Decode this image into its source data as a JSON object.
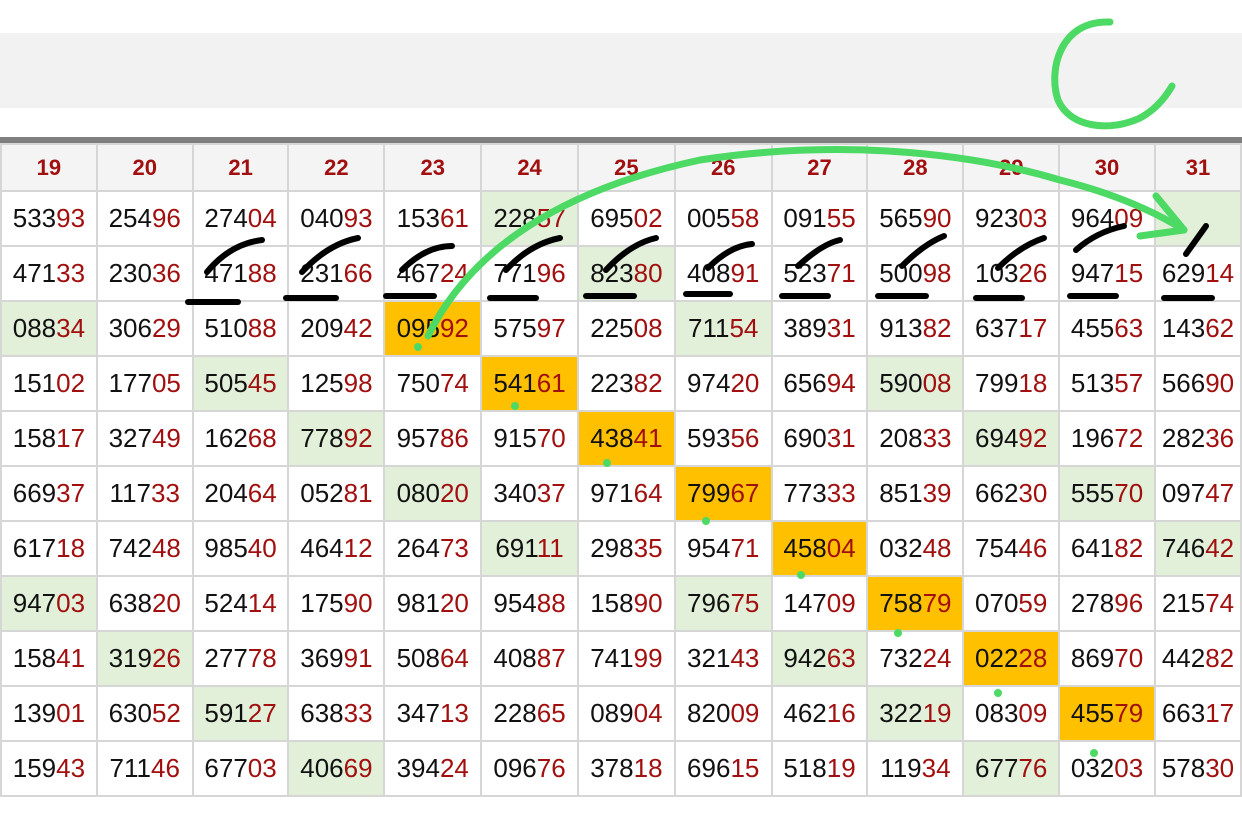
{
  "columns": [
    "19",
    "20",
    "21",
    "22",
    "23",
    "24",
    "25",
    "26",
    "27",
    "28",
    "29",
    "30",
    "31"
  ],
  "rows": [
    [
      "53393",
      "25496",
      "27404",
      "04093",
      "15361",
      "22857",
      "69502",
      "00558",
      "09155",
      "56590",
      "92303",
      "96409",
      ""
    ],
    [
      "47133",
      "23036",
      "47188",
      "23166",
      "46724",
      "77196",
      "82380",
      "40891",
      "52371",
      "50098",
      "10326",
      "94715",
      "62914"
    ],
    [
      "08834",
      "30629",
      "51088",
      "20942",
      "09592",
      "57597",
      "22508",
      "71154",
      "38931",
      "91382",
      "63717",
      "45563",
      "14362"
    ],
    [
      "15102",
      "17705",
      "50545",
      "12598",
      "75074",
      "54161",
      "22382",
      "97420",
      "65694",
      "59008",
      "79918",
      "51357",
      "56690"
    ],
    [
      "15817",
      "32749",
      "16268",
      "77892",
      "95786",
      "91570",
      "43841",
      "59356",
      "69031",
      "20833",
      "69492",
      "19672",
      "28236"
    ],
    [
      "66937",
      "11733",
      "20464",
      "05281",
      "08020",
      "34037",
      "97164",
      "79967",
      "77333",
      "85139",
      "66230",
      "55570",
      "09747"
    ],
    [
      "61718",
      "74248",
      "98540",
      "46412",
      "26473",
      "69111",
      "29835",
      "95471",
      "45804",
      "03248",
      "75446",
      "64182",
      "74642"
    ],
    [
      "94703",
      "63820",
      "52414",
      "17590",
      "98120",
      "95488",
      "15890",
      "79675",
      "14709",
      "75879",
      "07059",
      "27896",
      "21574"
    ],
    [
      "15841",
      "31926",
      "27778",
      "36991",
      "50864",
      "40887",
      "74199",
      "32143",
      "94263",
      "73224",
      "02228",
      "86970",
      "44282"
    ],
    [
      "13901",
      "63052",
      "59127",
      "63833",
      "34713",
      "22865",
      "08904",
      "82009",
      "46216",
      "32219",
      "08309",
      "45579",
      "66317"
    ],
    [
      "15943",
      "71146",
      "67703",
      "40669",
      "39424",
      "09676",
      "37818",
      "69615",
      "51819",
      "11934",
      "67776",
      "03203",
      "57830"
    ]
  ],
  "highlights": {
    "green": [
      [
        0,
        5
      ],
      [
        0,
        12
      ],
      [
        1,
        6
      ],
      [
        2,
        0
      ],
      [
        2,
        7
      ],
      [
        3,
        2
      ],
      [
        3,
        9
      ],
      [
        4,
        3
      ],
      [
        4,
        10
      ],
      [
        5,
        4
      ],
      [
        5,
        11
      ],
      [
        6,
        5
      ],
      [
        6,
        12
      ],
      [
        7,
        0
      ],
      [
        7,
        7
      ],
      [
        8,
        1
      ],
      [
        8,
        8
      ],
      [
        9,
        2
      ],
      [
        9,
        9
      ],
      [
        10,
        3
      ],
      [
        10,
        10
      ]
    ],
    "gold": [
      [
        2,
        4
      ],
      [
        3,
        5
      ],
      [
        4,
        6
      ],
      [
        5,
        7
      ],
      [
        6,
        8
      ],
      [
        7,
        9
      ],
      [
        8,
        10
      ],
      [
        9,
        11
      ]
    ]
  },
  "colors": {
    "header_text": "#a10f0f",
    "lead_digits": "#111111",
    "tail_digits": "#a10f0f",
    "green_cell": "#e2f0d9",
    "gold_cell": "#ffc000",
    "annotation_green": "#4cd964",
    "annotation_black": "#000000"
  }
}
